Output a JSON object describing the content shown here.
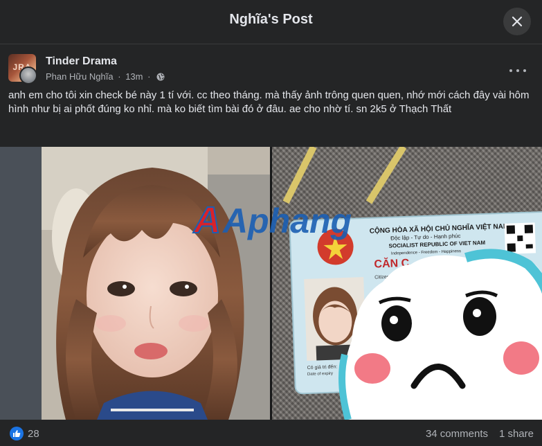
{
  "modal": {
    "title": "Nghĩa's Post"
  },
  "post": {
    "group_name": "Tinder Drama",
    "group_avatar_text": "JRA",
    "author": "Phan Hữu Nghĩa",
    "separator": "·",
    "time": "13m",
    "audience_icon": "globe-icon",
    "text": "anh em cho tôi xin check bé này 1 tí với. cc theo tháng. mà thấy ảnh trông quen quen, nhớ mới cách đây vài hôm hình như bị ai phốt đúng ko nhỉ. mà ko biết tìm bài đó ở đâu. ae cho nhờ tí. sn 2k5 ở Thạch Thất"
  },
  "media": {
    "watermark": "Aphang",
    "id_card": {
      "header_vn": "CỘNG HÒA XÃ HỘI CHỦ NGHĨA VIỆT NAM",
      "motto_vn": "Độc lập - Tự do - Hạnh phúc",
      "header_en": "SOCIALIST REPUBLIC OF VIET NAM",
      "motto_en": "Independence - Freedom - Happiness",
      "title": "CĂN C",
      "expiry_label": "Có giá trị đến:",
      "expiry_label_en": "Date of expiry",
      "citizen_label": "Citizen"
    }
  },
  "footer": {
    "like_count": "28",
    "comments": "34 comments",
    "shares": "1 share"
  },
  "colors": {
    "background": "#242526",
    "text": "#e4e6eb",
    "secondary_text": "#b0b3b8",
    "like_blue": "#1b74e4"
  }
}
